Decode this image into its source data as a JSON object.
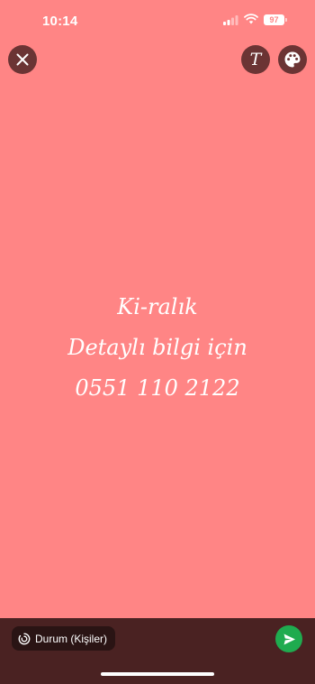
{
  "status_bar": {
    "time": "10:14",
    "battery": "97"
  },
  "toolbar": {
    "close_icon": "close-icon",
    "text_tool_glyph": "T",
    "palette_icon": "palette-icon"
  },
  "status_post": {
    "background_color": "#ff8585",
    "lines": [
      "Ki-ralık",
      "Detaylı bilgi için",
      "0551 110 2122"
    ]
  },
  "footer": {
    "audience_label": "Durum (Kişiler)",
    "send_icon": "send-icon"
  }
}
